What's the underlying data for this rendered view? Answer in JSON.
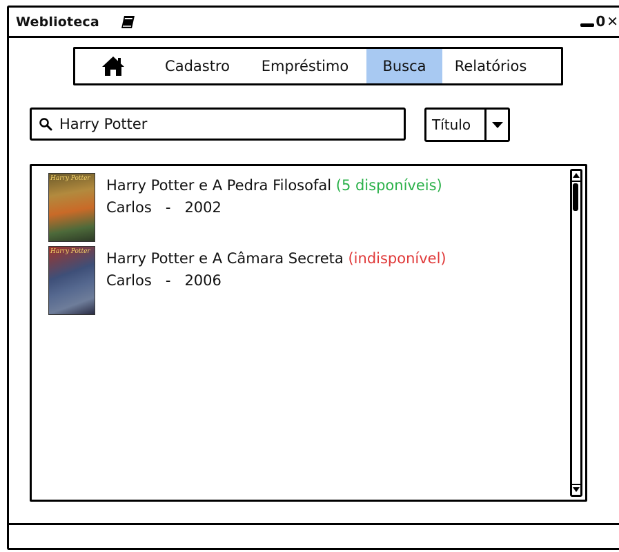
{
  "window": {
    "title": "Weblioteca",
    "controls": {
      "minimize": "_",
      "maximize": "0",
      "close": "✕"
    }
  },
  "nav": {
    "items": [
      {
        "label": "",
        "icon": "home-icon"
      },
      {
        "label": "Cadastro"
      },
      {
        "label": "Empréstimo"
      },
      {
        "label": "Busca",
        "active": true
      },
      {
        "label": "Relatórios"
      }
    ],
    "active_color": "#a8c9f2"
  },
  "search": {
    "value": "Harry Potter",
    "filter": "Título"
  },
  "results": [
    {
      "title": "Harry Potter e A Pedra Filosofal",
      "status": "(5 disponíveis)",
      "author": "Carlos",
      "separator": "-",
      "year": "2002",
      "cover_text": "Harry Potter",
      "status_color": "#2bb14a"
    },
    {
      "title": "Harry Potter e A Câmara Secreta",
      "status": "(indisponível)",
      "author": "Carlos",
      "separator": "-",
      "year": "2006",
      "cover_text": "Harry Potter",
      "status_color": "#e03a3a"
    }
  ]
}
